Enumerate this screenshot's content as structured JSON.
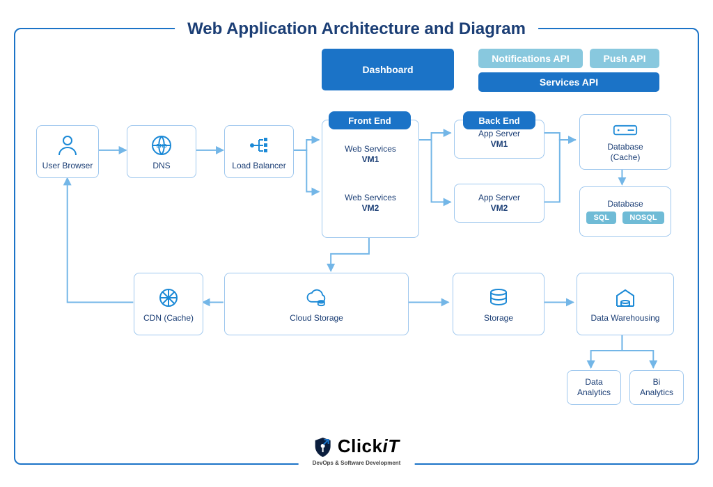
{
  "title": "Web Application Architecture and Diagram",
  "top_pills": {
    "dashboard": "Dashboard",
    "notifications": "Notifications API",
    "push": "Push API",
    "services": "Services API"
  },
  "groups": {
    "frontend": "Front End",
    "backend": "Back End"
  },
  "nodes": {
    "user_browser": "User Browser",
    "dns": "DNS",
    "load_balancer": "Load Balancer",
    "web_services_label": "Web Services",
    "web_vm1": "VM1",
    "web_vm2": "VM2",
    "app_server_label": "App Server",
    "app_vm1": "VM1",
    "app_vm2": "VM2",
    "database_cache": "Database\n(Cache)",
    "database": "Database",
    "sql": "SQL",
    "nosql": "NOSQL",
    "cdn_cache": "CDN (Cache)",
    "cloud_storage": "Cloud Storage",
    "storage": "Storage",
    "data_warehousing": "Data Warehousing",
    "data_analytics": "Data\nAnalytics",
    "bi_analytics": "Bi\nAnalytics"
  },
  "brand": {
    "name_left": "Click",
    "name_right": "iT",
    "subtitle": "DevOps & Software Development"
  },
  "colors": {
    "accent": "#1b73c7",
    "light_accent": "#88c8de",
    "node_border": "#9ec7ee",
    "line": "#73b6e7"
  }
}
